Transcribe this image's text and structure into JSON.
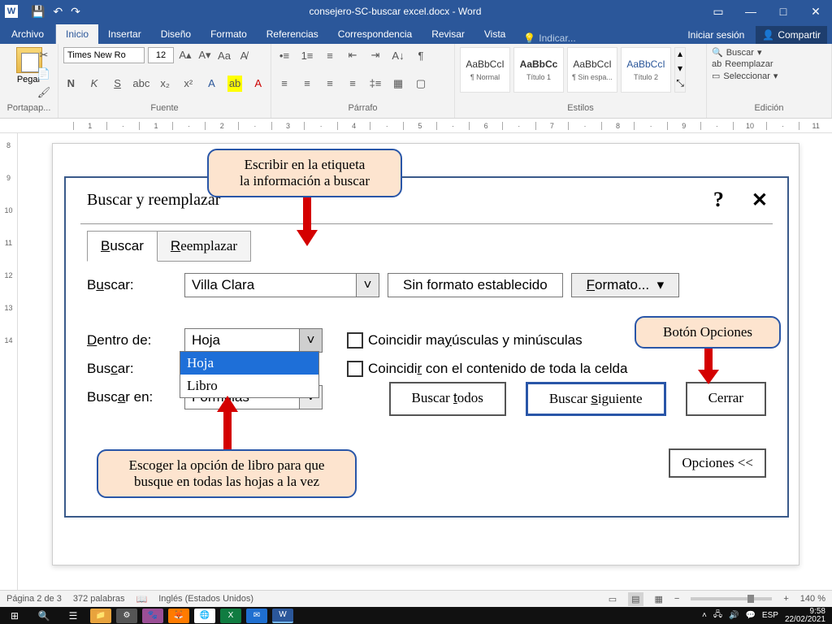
{
  "titlebar": {
    "title": "consejero-SC-buscar excel.docx - Word"
  },
  "tabs": {
    "file": "Archivo",
    "items": [
      "Inicio",
      "Insertar",
      "Diseño",
      "Formato",
      "Referencias",
      "Correspondencia",
      "Revisar",
      "Vista"
    ],
    "tell_me": "Indicar...",
    "signin": "Iniciar sesión",
    "share": "Compartir"
  },
  "ribbon": {
    "clipboard": {
      "paste": "Pegar",
      "label": "Portapap..."
    },
    "font": {
      "name": "Times New Ro",
      "size": "12",
      "label": "Fuente"
    },
    "paragraph": {
      "label": "Párrafo"
    },
    "styles": {
      "label": "Estilos",
      "items": [
        {
          "preview": "AaBbCcI",
          "name": "¶ Normal"
        },
        {
          "preview": "AaBbCc",
          "name": "Título 1"
        },
        {
          "preview": "AaBbCcI",
          "name": "¶ Sin espa..."
        },
        {
          "preview": "AaBbCcI",
          "name": "Título 2"
        }
      ]
    },
    "editing": {
      "find": "Buscar",
      "replace": "Reemplazar",
      "select": "Seleccionar",
      "label": "Edición"
    }
  },
  "dialog": {
    "title": "Buscar y reemplazar",
    "tab_find": "Buscar",
    "tab_replace": "Reemplazar",
    "find_label": "Buscar:",
    "find_value": "Villa Clara",
    "format_status": "Sin formato establecido",
    "format_btn": "Formato...",
    "within_label": "Dentro de:",
    "within_value": "Hoja",
    "within_options": [
      "Hoja",
      "Libro"
    ],
    "search_label": "Buscar:",
    "lookin_label": "Buscar en:",
    "lookin_value": "Fórmulas",
    "match_case": "Coincidir mayúsculas y minúsculas",
    "match_entire": "Coincidir con el contenido de toda la celda",
    "options_btn": "Opciones <<",
    "find_all": "Buscar todos",
    "find_next": "Buscar siguiente",
    "close": "Cerrar"
  },
  "callouts": {
    "top": "Escribir en la etiqueta\nla información a buscar",
    "right": "Botón Opciones",
    "bottom": "Escoger la opción de libro para que\nbusque en todas las hojas a la vez"
  },
  "statusbar": {
    "page": "Página 2 de 3",
    "words": "372 palabras",
    "lang": "Inglés (Estados Unidos)",
    "zoom": "140 %"
  },
  "taskbar": {
    "lang": "ESP",
    "time": "9:58",
    "date": "22/02/2021"
  }
}
